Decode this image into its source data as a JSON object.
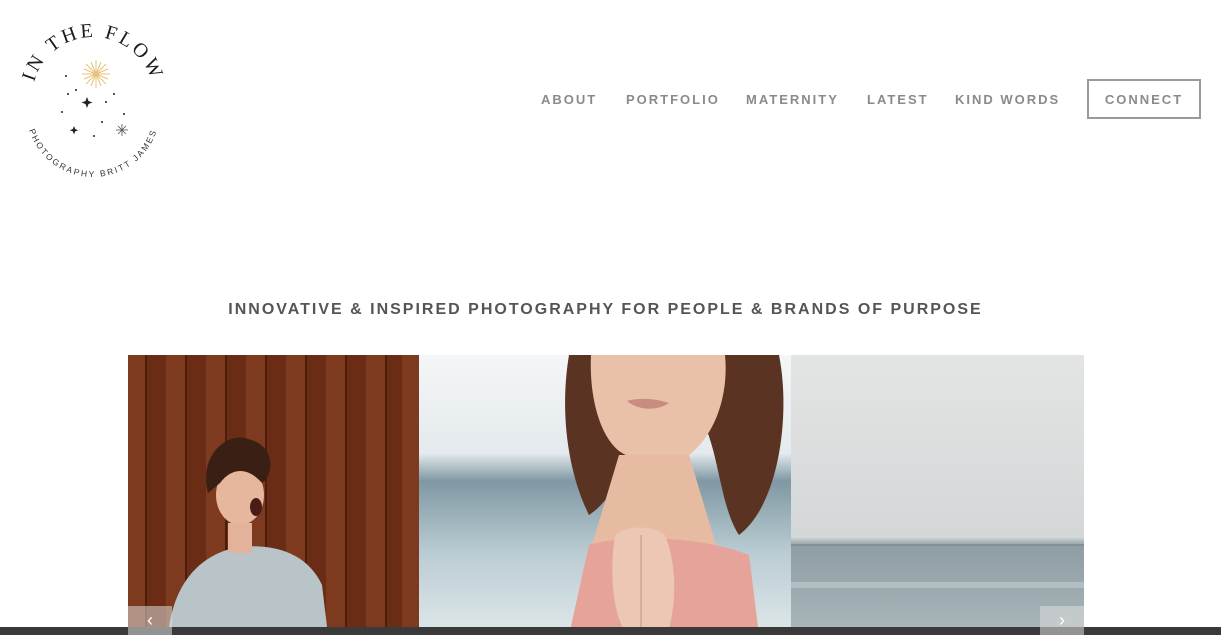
{
  "brand": {
    "logo_title": "IN THE FLOW",
    "logo_subtitle": "PHOTOGRAPHY BRITT JAMES"
  },
  "nav": {
    "items": [
      {
        "label": "ABOUT"
      },
      {
        "label": "PORTFOLIO"
      },
      {
        "label": "MATERNITY"
      },
      {
        "label": "LATEST"
      },
      {
        "label": "KIND WORDS"
      }
    ],
    "cta_label": "CONNECT"
  },
  "hero": {
    "tagline": "INNOVATIVE & INSPIRED PHOTOGRAPHY FOR PEOPLE & BRANDS OF PURPOSE"
  },
  "gallery": {
    "photos": [
      {
        "icon": "photo-woman-laughing-wood-wall"
      },
      {
        "icon": "photo-woman-namaste-beach"
      },
      {
        "icon": "photo-ocean-horizon"
      }
    ],
    "prev_icon": "chevron-left-icon",
    "next_icon": "chevron-right-icon"
  },
  "colors": {
    "nav_text": "#8a8a8a",
    "tagline_text": "#555555",
    "logo_accent": "#e8c27a"
  }
}
